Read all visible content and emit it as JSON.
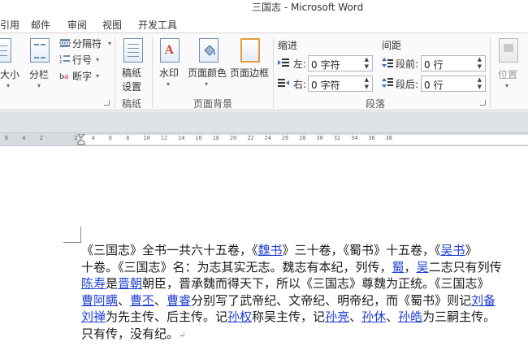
{
  "window": {
    "title": "三国志 - Microsoft Word"
  },
  "tabs": [
    "引用",
    "邮件",
    "审阅",
    "视图",
    "开发工具"
  ],
  "ribbon": {
    "page_setup": {
      "size_label": "大小",
      "columns_label": "分栏",
      "breaks_label": "分隔符",
      "line_numbers_label": "行号",
      "hyphenation_label": "断字"
    },
    "draft": {
      "label_line1": "稿纸",
      "label_line2": "设置",
      "group": "稿纸"
    },
    "background": {
      "watermark": "水印",
      "page_color": "页面颜色",
      "page_border": "页面边框",
      "group": "页面背景"
    },
    "paragraph": {
      "indent_header": "缩进",
      "spacing_header": "间距",
      "left_label": "左:",
      "right_label": "右:",
      "left_value": "0 字符",
      "right_value": "0 字符",
      "before_label": "段前:",
      "after_label": "段后:",
      "before_value": "0 行",
      "after_value": "0 行",
      "group": "段落"
    },
    "arrange": {
      "position": "位置"
    }
  },
  "ruler": {
    "numbers": [
      "6",
      "4",
      "2",
      "",
      "2",
      "4",
      "6",
      "8",
      "10",
      "12",
      "14",
      "16",
      "18",
      "20",
      "22",
      "24",
      "26",
      "28",
      "30",
      "32",
      "34",
      "36",
      "38"
    ]
  },
  "document": {
    "lines": [
      [
        {
          "t": "《三国志》全书一共六十五卷，《"
        },
        {
          "t": "魏书",
          "link": true
        },
        {
          "t": "》三十卷，《蜀书》十五卷，《"
        },
        {
          "t": "吴书",
          "link": true
        },
        {
          "t": "》"
        }
      ],
      [
        {
          "t": "十卷。《三国志》名：为志其实无志。魏志有本纪，列传，"
        },
        {
          "t": "蜀",
          "link": true
        },
        {
          "t": "，"
        },
        {
          "t": "吴",
          "link": true
        },
        {
          "t": "二志只有列传"
        }
      ],
      [
        {
          "t": "陈寿",
          "link": true
        },
        {
          "t": "是"
        },
        {
          "t": "晋朝",
          "link": true
        },
        {
          "t": "朝臣，晋承魏而得天下，所以《三国志》尊魏为正统。《三国志》"
        }
      ],
      [
        {
          "t": "曹阿瞒",
          "link": true
        },
        {
          "t": "、"
        },
        {
          "t": "曹丕",
          "link": true
        },
        {
          "t": "、"
        },
        {
          "t": "曹睿",
          "link": true
        },
        {
          "t": "分别写了武帝纪、文帝纪、明帝纪，而《蜀书》则记"
        },
        {
          "t": "刘备",
          "link": true
        }
      ],
      [
        {
          "t": "刘禅",
          "link": true
        },
        {
          "t": "为先主传、后主传。记"
        },
        {
          "t": "孙权",
          "link": true
        },
        {
          "t": "称吴主传，记"
        },
        {
          "t": "孙亮",
          "link": true
        },
        {
          "t": "、"
        },
        {
          "t": "孙休",
          "link": true
        },
        {
          "t": "、"
        },
        {
          "t": "孙皓",
          "link": true
        },
        {
          "t": "为三嗣主传。"
        }
      ],
      [
        {
          "t": "只有传，没有纪。"
        },
        {
          "t": "↵",
          "pm": true
        }
      ]
    ]
  }
}
